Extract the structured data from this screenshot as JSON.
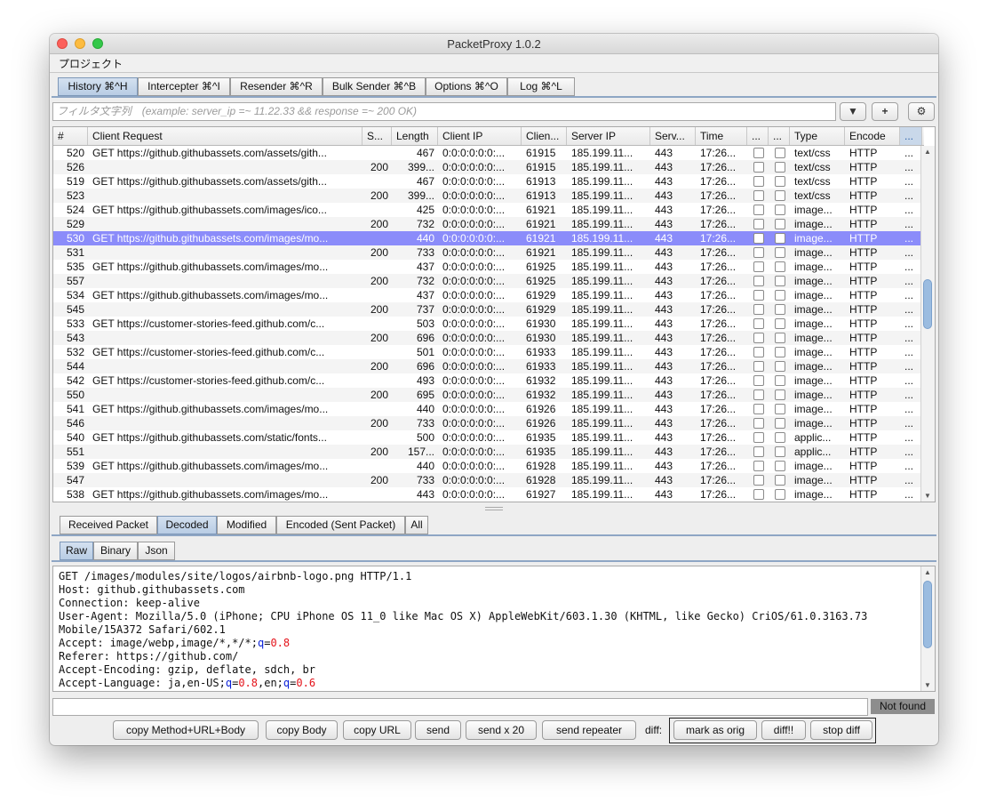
{
  "window": {
    "title": "PacketProxy 1.0.2"
  },
  "menu": {
    "project": "プロジェクト"
  },
  "main_tabs": [
    {
      "label": "History ⌘^H",
      "selected": true
    },
    {
      "label": "Intercepter ⌘^I",
      "selected": false
    },
    {
      "label": "Resender ⌘^R",
      "selected": false
    },
    {
      "label": "Bulk Sender ⌘^B",
      "selected": false
    },
    {
      "label": "Options ⌘^O",
      "selected": false
    },
    {
      "label": "Log ⌘^L",
      "selected": false
    }
  ],
  "filter": {
    "placeholder": "フィルタ文字列　(example: server_ip =~ 11.22.33 && response =~ 200 OK)",
    "icons": [
      "chevron-down-icon",
      "plus-icon",
      "gear-icon"
    ]
  },
  "table": {
    "columns": [
      "#",
      "Client Request",
      "S...",
      "Length",
      "Client IP",
      "Clien...",
      "Server IP",
      "Serv...",
      "Time",
      "...",
      "...",
      "Type",
      "Encode",
      "..."
    ],
    "selected_row": 6,
    "rows": [
      [
        "520",
        "GET https://github.githubassets.com/assets/gith...",
        "",
        "467",
        "0:0:0:0:0:0:...",
        "61915",
        "185.199.11...",
        "443",
        "17:26...",
        "text/css",
        "HTTP",
        "..."
      ],
      [
        "526",
        "",
        "200",
        "399...",
        "0:0:0:0:0:0:...",
        "61915",
        "185.199.11...",
        "443",
        "17:26...",
        "text/css",
        "HTTP",
        "..."
      ],
      [
        "519",
        "GET https://github.githubassets.com/assets/gith...",
        "",
        "467",
        "0:0:0:0:0:0:...",
        "61913",
        "185.199.11...",
        "443",
        "17:26...",
        "text/css",
        "HTTP",
        "..."
      ],
      [
        "523",
        "",
        "200",
        "399...",
        "0:0:0:0:0:0:...",
        "61913",
        "185.199.11...",
        "443",
        "17:26...",
        "text/css",
        "HTTP",
        "..."
      ],
      [
        "524",
        "GET https://github.githubassets.com/images/ico...",
        "",
        "425",
        "0:0:0:0:0:0:...",
        "61921",
        "185.199.11...",
        "443",
        "17:26...",
        "image...",
        "HTTP",
        "..."
      ],
      [
        "529",
        "",
        "200",
        "732",
        "0:0:0:0:0:0:...",
        "61921",
        "185.199.11...",
        "443",
        "17:26...",
        "image...",
        "HTTP",
        "..."
      ],
      [
        "530",
        "GET https://github.githubassets.com/images/mo...",
        "",
        "440",
        "0:0:0:0:0:0:...",
        "61921",
        "185.199.11...",
        "443",
        "17:26...",
        "image...",
        "HTTP",
        "..."
      ],
      [
        "531",
        "",
        "200",
        "733",
        "0:0:0:0:0:0:...",
        "61921",
        "185.199.11...",
        "443",
        "17:26...",
        "image...",
        "HTTP",
        "..."
      ],
      [
        "535",
        "GET https://github.githubassets.com/images/mo...",
        "",
        "437",
        "0:0:0:0:0:0:...",
        "61925",
        "185.199.11...",
        "443",
        "17:26...",
        "image...",
        "HTTP",
        "..."
      ],
      [
        "557",
        "",
        "200",
        "732",
        "0:0:0:0:0:0:...",
        "61925",
        "185.199.11...",
        "443",
        "17:26...",
        "image...",
        "HTTP",
        "..."
      ],
      [
        "534",
        "GET https://github.githubassets.com/images/mo...",
        "",
        "437",
        "0:0:0:0:0:0:...",
        "61929",
        "185.199.11...",
        "443",
        "17:26...",
        "image...",
        "HTTP",
        "..."
      ],
      [
        "545",
        "",
        "200",
        "737",
        "0:0:0:0:0:0:...",
        "61929",
        "185.199.11...",
        "443",
        "17:26...",
        "image...",
        "HTTP",
        "..."
      ],
      [
        "533",
        "GET https://customer-stories-feed.github.com/c...",
        "",
        "503",
        "0:0:0:0:0:0:...",
        "61930",
        "185.199.11...",
        "443",
        "17:26...",
        "image...",
        "HTTP",
        "..."
      ],
      [
        "543",
        "",
        "200",
        "696",
        "0:0:0:0:0:0:...",
        "61930",
        "185.199.11...",
        "443",
        "17:26...",
        "image...",
        "HTTP",
        "..."
      ],
      [
        "532",
        "GET https://customer-stories-feed.github.com/c...",
        "",
        "501",
        "0:0:0:0:0:0:...",
        "61933",
        "185.199.11...",
        "443",
        "17:26...",
        "image...",
        "HTTP",
        "..."
      ],
      [
        "544",
        "",
        "200",
        "696",
        "0:0:0:0:0:0:...",
        "61933",
        "185.199.11...",
        "443",
        "17:26...",
        "image...",
        "HTTP",
        "..."
      ],
      [
        "542",
        "GET https://customer-stories-feed.github.com/c...",
        "",
        "493",
        "0:0:0:0:0:0:...",
        "61932",
        "185.199.11...",
        "443",
        "17:26...",
        "image...",
        "HTTP",
        "..."
      ],
      [
        "550",
        "",
        "200",
        "695",
        "0:0:0:0:0:0:...",
        "61932",
        "185.199.11...",
        "443",
        "17:26...",
        "image...",
        "HTTP",
        "..."
      ],
      [
        "541",
        "GET https://github.githubassets.com/images/mo...",
        "",
        "440",
        "0:0:0:0:0:0:...",
        "61926",
        "185.199.11...",
        "443",
        "17:26...",
        "image...",
        "HTTP",
        "..."
      ],
      [
        "546",
        "",
        "200",
        "733",
        "0:0:0:0:0:0:...",
        "61926",
        "185.199.11...",
        "443",
        "17:26...",
        "image...",
        "HTTP",
        "..."
      ],
      [
        "540",
        "GET https://github.githubassets.com/static/fonts...",
        "",
        "500",
        "0:0:0:0:0:0:...",
        "61935",
        "185.199.11...",
        "443",
        "17:26...",
        "applic...",
        "HTTP",
        "..."
      ],
      [
        "551",
        "",
        "200",
        "157...",
        "0:0:0:0:0:0:...",
        "61935",
        "185.199.11...",
        "443",
        "17:26...",
        "applic...",
        "HTTP",
        "..."
      ],
      [
        "539",
        "GET https://github.githubassets.com/images/mo...",
        "",
        "440",
        "0:0:0:0:0:0:...",
        "61928",
        "185.199.11...",
        "443",
        "17:26...",
        "image...",
        "HTTP",
        "..."
      ],
      [
        "547",
        "",
        "200",
        "733",
        "0:0:0:0:0:0:...",
        "61928",
        "185.199.11...",
        "443",
        "17:26...",
        "image...",
        "HTTP",
        "..."
      ],
      [
        "538",
        "GET https://github.githubassets.com/images/mo...",
        "",
        "443",
        "0:0:0:0:0:0:...",
        "61927",
        "185.199.11...",
        "443",
        "17:26...",
        "image...",
        "HTTP",
        "..."
      ]
    ]
  },
  "packet_tabs": [
    {
      "label": "Received Packet",
      "selected": false
    },
    {
      "label": "Decoded",
      "selected": true
    },
    {
      "label": "Modified",
      "selected": false
    },
    {
      "label": "Encoded (Sent Packet)",
      "selected": false
    },
    {
      "label": "All",
      "selected": false
    }
  ],
  "view_tabs": [
    {
      "label": "Raw",
      "selected": true
    },
    {
      "label": "Binary",
      "selected": false
    },
    {
      "label": "Json",
      "selected": false
    }
  ],
  "raw": {
    "lines": [
      [
        {
          "t": "GET /images/modules/site/logos/airbnb-logo.png HTTP/1.1",
          "c": ""
        }
      ],
      [
        {
          "t": "Host: github.githubassets.com",
          "c": ""
        }
      ],
      [
        {
          "t": "Connection: keep-alive",
          "c": ""
        }
      ],
      [
        {
          "t": "User-Agent: Mozilla/5.0 (iPhone; CPU iPhone OS 11_0 like Mac OS X) AppleWebKit/603.1.30 (KHTML, like Gecko) CriOS/61.0.3163.73",
          "c": ""
        }
      ],
      [
        {
          "t": "Mobile/15A372 Safari/602.1",
          "c": ""
        }
      ],
      [
        {
          "t": "Accept: image/webp,image/*,*/*;",
          "c": ""
        },
        {
          "t": "q",
          "c": "b"
        },
        {
          "t": "=",
          "c": ""
        },
        {
          "t": "0.8",
          "c": "r"
        }
      ],
      [
        {
          "t": "Referer: https://github.com/",
          "c": ""
        }
      ],
      [
        {
          "t": "Accept-Encoding: gzip, deflate, sdch, br",
          "c": ""
        }
      ],
      [
        {
          "t": "Accept-Language: ja,en-US;",
          "c": ""
        },
        {
          "t": "q",
          "c": "b"
        },
        {
          "t": "=",
          "c": ""
        },
        {
          "t": "0.8",
          "c": "r"
        },
        {
          "t": ",en;",
          "c": ""
        },
        {
          "t": "q",
          "c": "b"
        },
        {
          "t": "=",
          "c": ""
        },
        {
          "t": "0.6",
          "c": "r"
        }
      ]
    ]
  },
  "search_status": "Not found",
  "buttons": {
    "copy_method_url_body": "copy Method+URL+Body",
    "copy_body": "copy Body",
    "copy_url": "copy URL",
    "send": "send",
    "send_x20": "send x 20",
    "send_repeater": "send repeater",
    "diff_label": "diff:",
    "mark_as_orig": "mark as orig",
    "diff": "diff!!",
    "stop_diff": "stop diff"
  }
}
